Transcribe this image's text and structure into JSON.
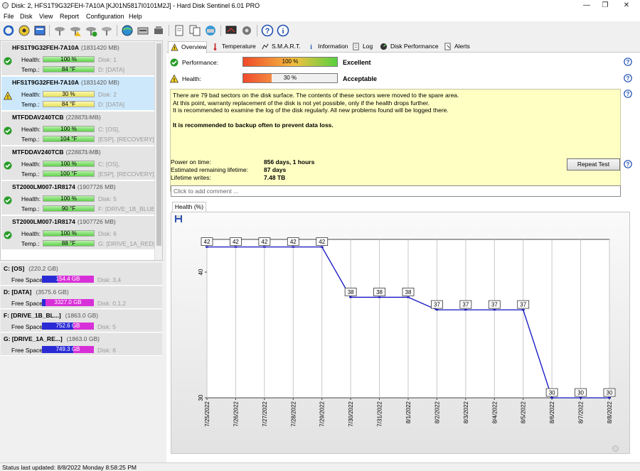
{
  "window": {
    "title": "Disk: 2, HFS1T9G32FEH-7A10A [KJ01N5817I0101M2J]  -  Hard Disk Sentinel 6.01 PRO",
    "controls": [
      "—",
      "❐",
      "✕"
    ]
  },
  "menu": [
    "File",
    "Disk",
    "View",
    "Report",
    "Configuration",
    "Help"
  ],
  "toolbar_icons": [
    "refresh-icon",
    "disk-status-icon",
    "report-icon",
    "disk-tool-icon",
    "disk-tool-warn-icon",
    "disk-tool-check-icon",
    "disk-tool-2-icon",
    "globe-icon",
    "network-disk-icon",
    "disk-transfer-icon",
    "document-icon",
    "copy-icon",
    "network-icon",
    "monitor-icon",
    "settings-icon",
    "help-icon",
    "info-icon"
  ],
  "disks": [
    {
      "name": "HFS1T9G32FEH-7A10A",
      "size": "(1831420 MB)",
      "health": "100 %",
      "temp": "84 °F",
      "disk_no": "Disk: 1",
      "drives": "D: [DATA]",
      "status": "ok",
      "selected": false
    },
    {
      "name": "HFS1T9G32FEH-7A10A",
      "size": "(1831420 MB)",
      "health": "30 %",
      "temp": "84 °F",
      "disk_no": "Disk: 2",
      "drives": "D: [DATA]",
      "status": "warn",
      "selected": true
    },
    {
      "name": "MTFDDAV240TCB",
      "size": "(228871 MB)",
      "health": "100 %",
      "temp": "104 °F",
      "disk_no": "Disk: 3",
      "drives": "C: [OS],",
      "drives2": "[ESP],  [RECOVERY]",
      "status": "ok",
      "selected": false
    },
    {
      "name": "MTFDDAV240TCB",
      "size": "(228871 MB)",
      "health": "100 %",
      "temp": "100 °F",
      "disk_no": "Disk: 4",
      "drives": "C: [OS],",
      "drives2": "[ESP],  [RECOVERY]",
      "status": "ok",
      "selected": false
    },
    {
      "name": "ST2000LM007-1R8174",
      "size": "(1907726 MB)",
      "health": "100 %",
      "temp": "90 °F",
      "disk_no": "Disk: 5",
      "drives": "F: [DRIVE_1B_BLUE]",
      "status": "ok",
      "selected": false
    },
    {
      "name": "ST2000LM007-1R8174",
      "size": "(1907726 MB)",
      "health": "100 %",
      "temp": "88 °F",
      "disk_no": "Disk: 6",
      "drives": "G: [DRIVE_1A_RED]",
      "status": "ok",
      "selected": false
    }
  ],
  "labels": {
    "health": "Health:",
    "temp": "Temp.:",
    "free_space": "Free Space"
  },
  "volumes": [
    {
      "name": "C: [OS]",
      "size": "(220.2 GB)",
      "free": "154.4 GB",
      "disks": "Disk: 3,4",
      "fill": 0.7
    },
    {
      "name": "D: [DATA]",
      "size": "(3575.6 GB)",
      "free": "3327.0 GB",
      "disks": "Disk: 0,1,2",
      "fill": 0.93
    },
    {
      "name": "F: [DRIVE_1B_BL...]",
      "size": "(1863.0 GB)",
      "free": "752.6 GB",
      "disks": "Disk: 5",
      "fill": 0.4
    },
    {
      "name": "G: [DRIVE_1A_RE...]",
      "size": "(1863.0 GB)",
      "free": "749.3 GB",
      "disks": "Disk: 6",
      "fill": 0.4
    }
  ],
  "tabs": [
    {
      "label": "Overview",
      "icon": "warning-icon"
    },
    {
      "label": "Temperature",
      "icon": "thermometer-icon"
    },
    {
      "label": "S.M.A.R.T.",
      "icon": "smart-icon"
    },
    {
      "label": "Information",
      "icon": "info-icon"
    },
    {
      "label": "Log",
      "icon": "log-icon"
    },
    {
      "label": "Disk Performance",
      "icon": "performance-icon"
    },
    {
      "label": "Alerts",
      "icon": "alerts-icon"
    }
  ],
  "overview": {
    "performance": {
      "label": "Performance:",
      "value": "100 %",
      "percent": 100,
      "verdict": "Excellent"
    },
    "health": {
      "label": "Health:",
      "value": "30 %",
      "percent": 30,
      "verdict": "Acceptable"
    },
    "message_lines": [
      "There are 79 bad sectors on the disk surface. The contents of these sectors were moved to the spare area.",
      "At this point, warranty replacement of the disk is not yet possible, only if the health drops further.",
      "It is recommended to examine the log of the disk regularly. All new problems found will be logged there."
    ],
    "message_warning": "It is recommended to backup often to prevent data loss.",
    "stats": [
      {
        "label": "Power on time:",
        "value": "856 days, 1 hours"
      },
      {
        "label": "Estimated remaining lifetime:",
        "value": "87 days"
      },
      {
        "label": "Lifetime writes:",
        "value": "7.48 TB"
      }
    ],
    "repeat_test": "Repeat Test",
    "comment_placeholder": "Click to add comment ...",
    "chart_tab": "Health (%)"
  },
  "chart_data": {
    "type": "line",
    "x": [
      "7/25/2022",
      "7/26/2022",
      "7/27/2022",
      "7/28/2022",
      "7/29/2022",
      "7/30/2022",
      "7/31/2022",
      "8/1/2022",
      "8/2/2022",
      "8/3/2022",
      "8/4/2022",
      "8/5/2022",
      "8/6/2022",
      "8/7/2022",
      "8/8/2022"
    ],
    "values": [
      42,
      42,
      42,
      42,
      42,
      38,
      38,
      38,
      37,
      37,
      37,
      37,
      30,
      30,
      30
    ],
    "yticks": [
      30,
      40
    ],
    "ylim": [
      30,
      42.6
    ],
    "color": "#1010c0"
  },
  "status": "Status last updated: 8/8/2022 Monday 8:58:25 PM"
}
